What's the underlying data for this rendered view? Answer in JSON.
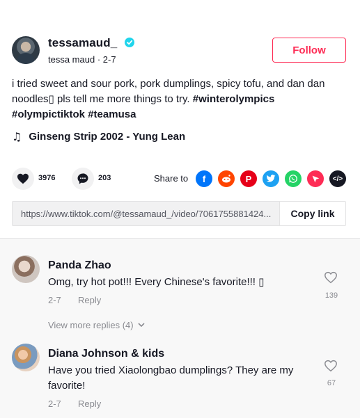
{
  "post": {
    "username": "tessamaud_",
    "display_name": "tessa maud",
    "date": "2-7",
    "follow_label": "Follow",
    "caption_text": "i tried sweet and sour pork, pork dumplings, spicy tofu, and dan dan noodles▯ pls tell me more things to try. ",
    "hashtags": [
      "#winterolympics",
      "#olympictiktok",
      "#teamusa"
    ],
    "music": "Ginseng Strip 2002 - Yung Lean",
    "likes": "3976",
    "comments": "203",
    "share_label": "Share to",
    "share_targets": [
      "facebook-icon",
      "reddit-icon",
      "pinterest-icon",
      "twitter-icon",
      "whatsapp-icon",
      "send-icon",
      "embed-icon"
    ],
    "link": "https://www.tiktok.com/@tessamaud_/video/7061755881424...",
    "copy_label": "Copy link"
  },
  "comments": [
    {
      "name": "Panda Zhao",
      "text": "Omg, try hot pot!!! Every Chinese's favorite!!! ▯",
      "date": "2-7",
      "reply_label": "Reply",
      "likes": "139",
      "view_more": "View more replies (4)"
    },
    {
      "name": "Diana Johnson & kids",
      "text": "Have you tried Xiaolongbao dumplings? They are my favorite!",
      "date": "2-7",
      "reply_label": "Reply",
      "likes": "67"
    }
  ],
  "colors": {
    "accent": "#fe2c55",
    "verified": "#20d5ec",
    "facebook": "#0075fa",
    "reddit": "#ff4500",
    "pinterest": "#e60019",
    "twitter": "#1da1f2",
    "whatsapp": "#25d366",
    "send": "#fe2c55",
    "embed": "#161823"
  }
}
